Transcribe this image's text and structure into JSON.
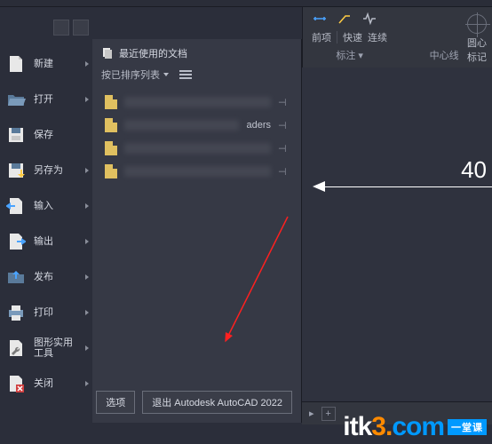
{
  "ribbon": {
    "item1": "前项",
    "quick": "快速",
    "cont": "连续",
    "annot_label": "标注 ▾",
    "circ": "圆心",
    "mark": "标记",
    "center": "中心线"
  },
  "canvas": {
    "dimension": "40"
  },
  "menu": {
    "new": "新建",
    "open": "打开",
    "save": "保存",
    "saveas": "另存为",
    "input": "输入",
    "output": "输出",
    "publish": "发布",
    "print": "打印",
    "drawing_util": "图形实用",
    "drawing_util2": "工具",
    "close": "关闭"
  },
  "recent": {
    "header": "最近使用的文档",
    "sort": "按已排序列表",
    "items": [
      {
        "name": "xxxxxxxx"
      },
      {
        "name": "xxxxxxxx aders",
        "suffix": "aders"
      },
      {
        "name": "xxxxxxxx"
      },
      {
        "name": "xxxxxxxx"
      }
    ]
  },
  "footer": {
    "options": "选项",
    "exit": "退出 Autodesk AutoCAD 2022"
  },
  "watermark": {
    "p1": "itk",
    "p2": "3",
    "dot": ".",
    "p3": "com",
    "tag": "一堂课"
  }
}
